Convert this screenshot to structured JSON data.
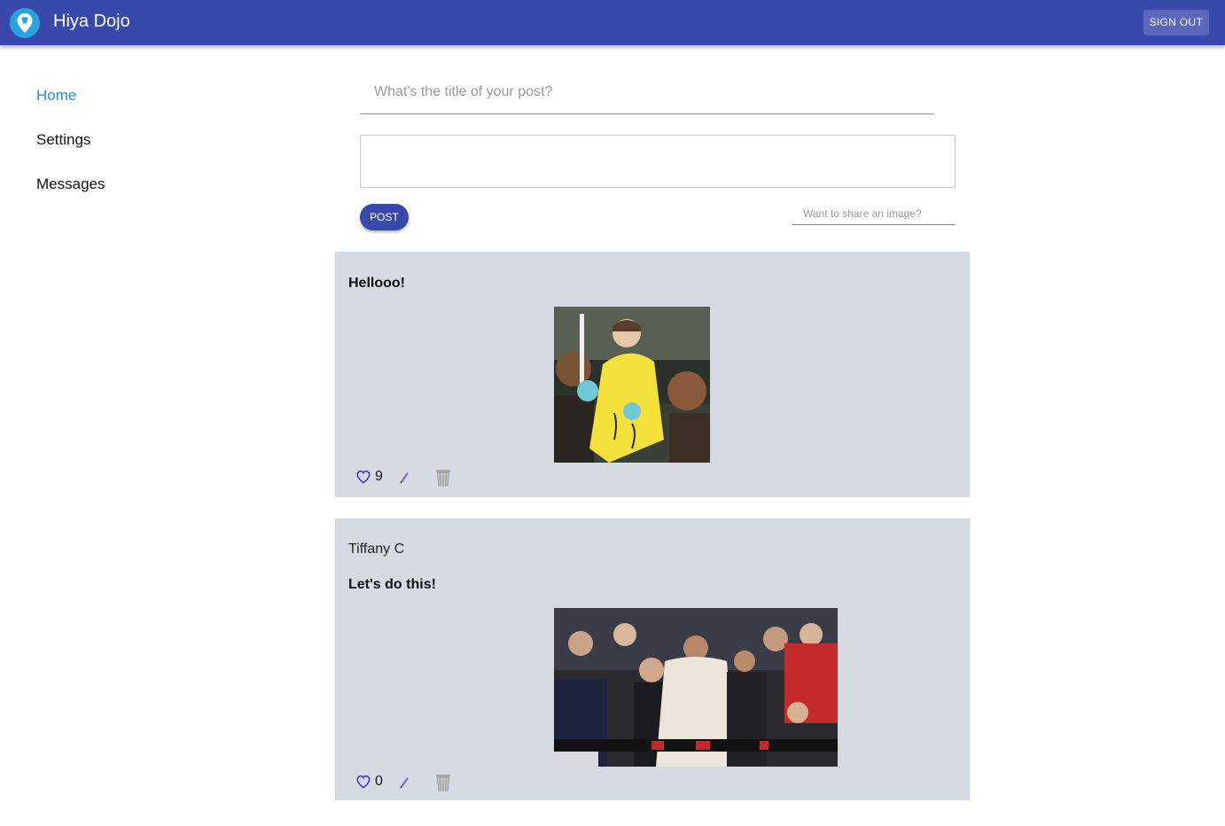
{
  "header": {
    "app_title": "Hiya Dojo",
    "sign_out_label": "SIGN OUT",
    "logo_icon": "map-pin-tooth-icon",
    "bar_color": "#3949ab"
  },
  "sidenav": {
    "items": [
      {
        "label": "Home",
        "active": true
      },
      {
        "label": "Settings",
        "active": false
      },
      {
        "label": "Messages",
        "active": false
      }
    ],
    "active_color": "#1a91c8"
  },
  "composer": {
    "title_placeholder": "What's the title of your post?",
    "title_value": "",
    "body_value": "",
    "post_label": "POST",
    "image_placeholder": "Want to share an image?"
  },
  "posts": [
    {
      "author": "",
      "title": "Hellooo!",
      "image": "girl-with-cotton-candy-gif",
      "likes": "9",
      "icons": [
        "heart-outline-icon",
        "pencil-icon",
        "trash-can-icon"
      ]
    },
    {
      "author": "Tiffany C",
      "title": "Let's do this!",
      "image": "basketball-crowd-dancing-gif",
      "likes": "0",
      "icons": [
        "heart-outline-icon",
        "pencil-icon",
        "trash-can-icon"
      ]
    }
  ]
}
